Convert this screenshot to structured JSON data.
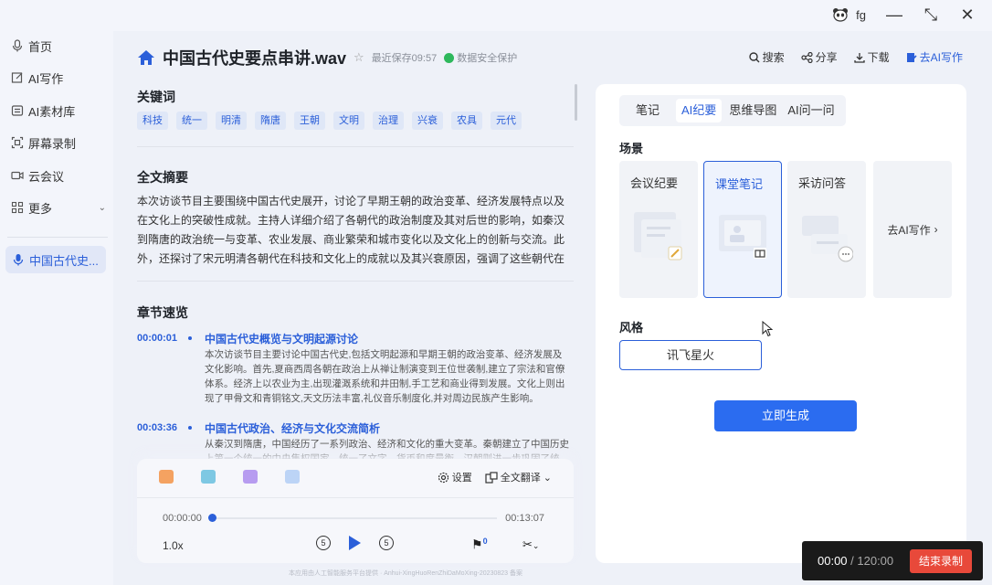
{
  "topbar": {
    "username": "fg",
    "minimize_label": "—",
    "fullscreen_label": "⤡",
    "close_label": "✕"
  },
  "sidebar": {
    "items": [
      {
        "label": "首页",
        "icon": "microphone-icon"
      },
      {
        "label": "AI写作",
        "icon": "edit-icon"
      },
      {
        "label": "AI素材库",
        "icon": "library-icon"
      },
      {
        "label": "屏幕录制",
        "icon": "screen-record-icon"
      },
      {
        "label": "云会议",
        "icon": "camera-icon"
      },
      {
        "label": "更多",
        "icon": "grid-icon"
      }
    ],
    "active_item": "中国古代史..."
  },
  "header": {
    "title": "中国古代史要点串讲.wav",
    "saved": "最近保存09:57",
    "secure": "数据安全保护",
    "tools": {
      "search": "搜索",
      "share": "分享",
      "download": "下载",
      "ai_write": "去AI写作"
    }
  },
  "keywords": {
    "heading": "关键词",
    "items": [
      "科技",
      "统一",
      "明清",
      "隋唐",
      "王朝",
      "文明",
      "治理",
      "兴衰",
      "农具",
      "元代"
    ]
  },
  "summary": {
    "heading": "全文摘要",
    "text": "本次访谈节目主要围绕中国古代史展开，讨论了早期王朝的政治变革、经济发展特点以及在文化上的突破性成就。主持人详细介绍了各朝代的政治制度及其对后世的影响，如秦汉到隋唐的政治统一与变革、农业发展、商业繁荣和城市变化以及文化上的创新与交流。此外，还探讨了宋元明清各朝代在科技和文化上的成就以及其兴衰原因，强调了这些朝代在经济治理模式对现代中国产生的深远影响。"
  },
  "chapters": {
    "heading": "章节速览",
    "items": [
      {
        "time": "00:00:01",
        "title": "中国古代史概览与文明起源讨论",
        "text": "本次访谈节目主要讨论中国古代史,包括文明起源和早期王朝的政治变革、经济发展及文化影响。首先,夏商西周各朝在政治上从禅让制演变到王位世袭制,建立了宗法和官僚体系。经济上以农业为主,出现灌溉系统和井田制,手工艺和商业得到发展。文化上则出现了甲骨文和青铜铭文,天文历法丰富,礼仪音乐制度化,并对周边民族产生影响。"
      },
      {
        "time": "00:03:36",
        "title": "中国古代政治、经济与文化交流简析",
        "text": "从秦汉到隋唐，中国经历了一系列政治、经济和文化的重大变革。秦朝建立了中国历史上第一个统一的中央集权国家，统一了文字、货币和度量衡，汉朝则进一步巩固了统一。"
      }
    ]
  },
  "player": {
    "settings": "设置",
    "translate": "全文翻译",
    "current": "00:00:00",
    "total": "00:13:07",
    "speed": "1.0x",
    "progress": 0,
    "flag_count": "0",
    "rewind_label": "5",
    "forward_label": "5"
  },
  "panel": {
    "tabs": [
      "笔记",
      "AI纪要",
      "思维导图",
      "AI问一问"
    ],
    "active_tab": 1,
    "scene_heading": "场景",
    "scenes": [
      "会议纪要",
      "课堂笔记",
      "采访问答"
    ],
    "selected_scene": 1,
    "more": "去AI写作",
    "style_heading": "风格",
    "style_value": "讯飞星火",
    "generate": "立即生成"
  },
  "footer": "本应用由人工智能服务平台提供 · Anhui-XingHuoRenZhiDaMoXing-20230823 备案",
  "recorder": {
    "elapsed": "00:00",
    "limit": " / 120:00",
    "stop": "结束录制",
    "stop_color": "#e8493a"
  },
  "colors": {
    "accent": "#2b5fd9",
    "primary_button": "#2b6cf0",
    "secure_green": "#2eb85c"
  }
}
